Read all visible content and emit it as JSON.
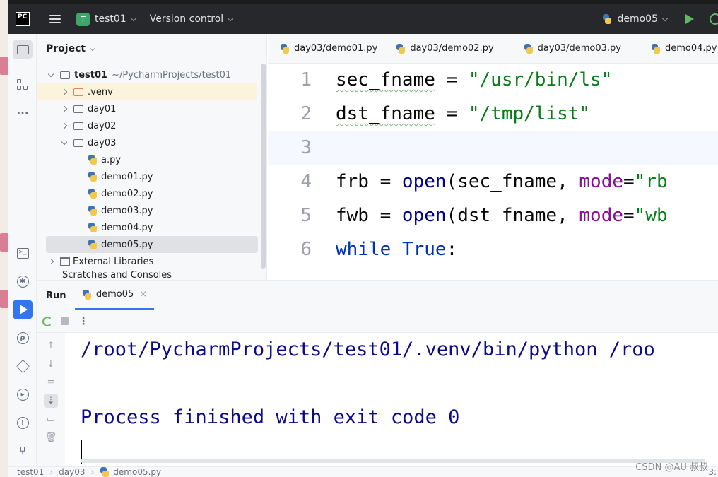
{
  "titlebar": {
    "logo": "PC",
    "project_badge": "T",
    "project_name": "test01",
    "version_control": "Version control",
    "run_config": "demo05"
  },
  "project_panel": {
    "title": "Project",
    "root": {
      "name": "test01",
      "path": "~/PycharmProjects/test01"
    },
    "items": [
      {
        "label": ".venv",
        "type": "folder"
      },
      {
        "label": "day01",
        "type": "folder"
      },
      {
        "label": "day02",
        "type": "folder"
      },
      {
        "label": "day03",
        "type": "folder"
      },
      {
        "label": "a.py",
        "type": "python"
      },
      {
        "label": "demo01.py",
        "type": "python"
      },
      {
        "label": "demo02.py",
        "type": "python"
      },
      {
        "label": "demo03.py",
        "type": "python"
      },
      {
        "label": "demo04.py",
        "type": "python"
      },
      {
        "label": "demo05.py",
        "type": "python"
      },
      {
        "label": "External Libraries",
        "type": "library"
      },
      {
        "label": "Scratches and Consoles",
        "type": "scratch"
      }
    ]
  },
  "editor": {
    "tabs": [
      "day03/demo01.py",
      "day03/demo02.py",
      "day03/demo03.py",
      "demo04.py"
    ],
    "line_numbers": [
      "1",
      "2",
      "3",
      "4",
      "5",
      "6"
    ],
    "code": {
      "l1_var": "sec_fname",
      "l1_op": " = ",
      "l1_str": "\"/usr/bin/ls\"",
      "l2_var": "dst_fname",
      "l2_op": " = ",
      "l2_str": "\"/tmp/list\"",
      "l4_a": "frb = ",
      "l4_fn": "open",
      "l4_b": "(sec_fname, ",
      "l4_param": "mode",
      "l4_c": "=",
      "l4_str": "\"rb",
      "l5_a": "fwb = ",
      "l5_fn": "open",
      "l5_b": "(dst_fname, ",
      "l5_param": "mode",
      "l5_c": "=",
      "l5_str": "\"wb",
      "l6_kw": "while",
      "l6_sp": " ",
      "l6_kw2": "True",
      "l6_colon": ":"
    }
  },
  "run_panel": {
    "title": "Run",
    "tab": "demo05",
    "close": "×",
    "more": "⋮",
    "console": [
      "/root/PycharmProjects/test01/.venv/bin/python /roo",
      "Process finished with exit code 0"
    ]
  },
  "statusbar": {
    "crumbs": [
      "test01",
      "day03",
      "demo05.py"
    ],
    "right": "3:",
    "watermark": "CSDN @AU 叔叔"
  },
  "colors": {
    "accent": "#3574f0",
    "string": "#067d17",
    "keyword": "#0033b3",
    "param": "#871094",
    "console_text": "#0a0a8a"
  }
}
